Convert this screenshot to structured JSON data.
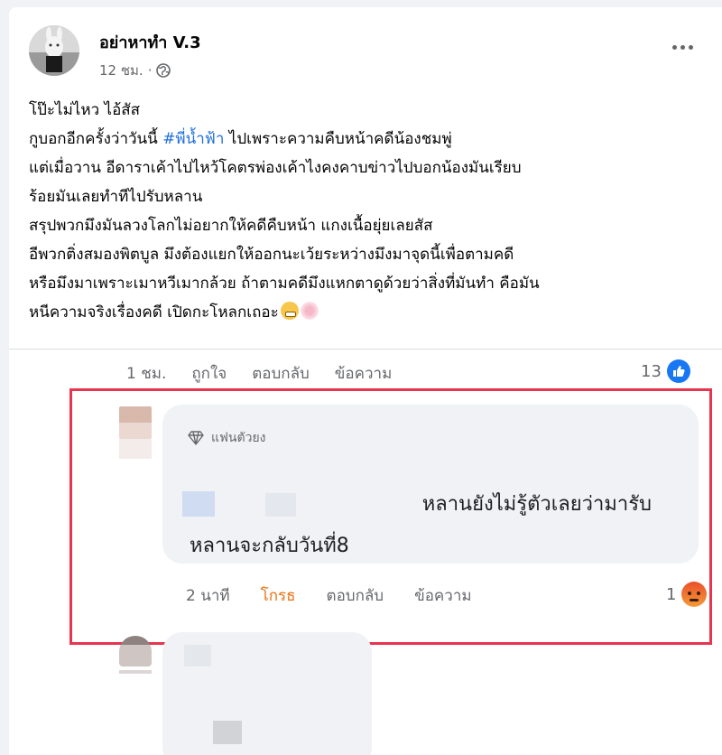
{
  "post": {
    "author": "อย่าหาทำ V.3",
    "time": "12 ชม.",
    "dot": "·",
    "lines": [
      {
        "pre": "โป๊ะไม่ไหว ไอ้สัส",
        "hashtag": "",
        "post": ""
      },
      {
        "pre": "กูบอกอีกครั้งว่าวันนี้ ",
        "hashtag": "#พี่น้ำฟ้า",
        "post": " ไปเพราะความคืบหน้าคดีน้องชมพู่"
      },
      {
        "pre": "แต่เมื่อวาน อีดาราเค้าไปไหว้โคตรพ่องเค้าไงคงคาบข่าวไปบอกน้องมันเรียบ",
        "hashtag": "",
        "post": ""
      },
      {
        "pre": "ร้อยมันเลยทำทีไปรับหลาน",
        "hashtag": "",
        "post": ""
      },
      {
        "pre": "สรุปพวกมึงมันลวงโลกไม่อยากให้คดีคืบหน้า แกงเนื้อยุ่ยเลยสัส",
        "hashtag": "",
        "post": ""
      },
      {
        "pre": "อีพวกติ่งสมองพิตบูล มึงต้องแยกให้ออกนะเว้ยระหว่างมึงมาจุดนี้เพื่อตามคดี",
        "hashtag": "",
        "post": ""
      },
      {
        "pre": "หรือมึงมาเพราะเมาหวีเมากล้วย ถ้าตามคดีมึงแหกตาดูด้วยว่าสิ่งที่มันทำ คือมัน",
        "hashtag": "",
        "post": ""
      },
      {
        "pre": "หนีความจริงเรื่องคดี เปิดกะโหลกเถอะ",
        "hashtag": "",
        "post": ""
      }
    ]
  },
  "post_actions": {
    "time": "1 ชม.",
    "like": "ถูกใจ",
    "reply": "ตอบกลับ",
    "message": "ข้อความ",
    "reaction_count": "13"
  },
  "comment": {
    "badge": "แฟนตัวยง",
    "line1": "หลานยังไม่รู้ตัวเลยว่ามารับ",
    "line2": "หลานจะกลับวันที่8",
    "time": "2 นาที",
    "reaction": "โกรธ",
    "reply": "ตอบกลับ",
    "message": "ข้อความ",
    "reaction_count": "1"
  },
  "colors": {
    "hashtag": "#216fdb",
    "highlight_border": "#e8344f",
    "angry_label": "#e9710f",
    "like_blue": "#1877f2"
  }
}
